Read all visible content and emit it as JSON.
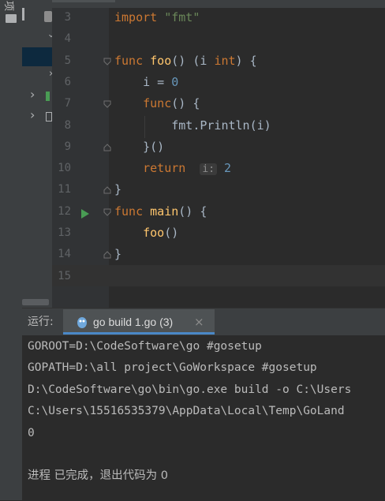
{
  "sidebar": {
    "vertical_label": "项",
    "chevrons": [
      "›",
      "›",
      "›",
      "›"
    ]
  },
  "editor": {
    "lines": [
      {
        "num": "3",
        "tokens": [
          [
            "kw",
            "import "
          ],
          [
            "str",
            "\"fmt\""
          ]
        ]
      },
      {
        "num": "4",
        "tokens": []
      },
      {
        "num": "5",
        "tokens": [
          [
            "kw",
            "func "
          ],
          [
            "fn",
            "foo"
          ],
          [
            "plain",
            "() (i "
          ],
          [
            "kw",
            "int"
          ],
          [
            "plain",
            ") {"
          ]
        ]
      },
      {
        "num": "6",
        "tokens": [
          [
            "plain",
            "    i = "
          ],
          [
            "num",
            "0"
          ]
        ]
      },
      {
        "num": "7",
        "tokens": [
          [
            "plain",
            "    "
          ],
          [
            "kw",
            "func"
          ],
          [
            "plain",
            "() {"
          ]
        ]
      },
      {
        "num": "8",
        "tokens": [
          [
            "plain",
            "        "
          ],
          [
            "pkgfn",
            "fmt.Println"
          ],
          [
            "plain",
            "(i)"
          ]
        ]
      },
      {
        "num": "9",
        "tokens": [
          [
            "plain",
            "    }()"
          ]
        ]
      },
      {
        "num": "10",
        "tokens": [
          [
            "plain",
            "    "
          ],
          [
            "kw",
            "return"
          ],
          [
            "plain",
            "  "
          ]
        ]
      },
      {
        "num": "11",
        "tokens": [
          [
            "plain",
            "}"
          ]
        ]
      },
      {
        "num": "12",
        "tokens": [
          [
            "kw",
            "func "
          ],
          [
            "fn",
            "main"
          ],
          [
            "plain",
            "() {"
          ]
        ]
      },
      {
        "num": "13",
        "tokens": [
          [
            "plain",
            "    "
          ],
          [
            "fn",
            "foo"
          ],
          [
            "plain",
            "()"
          ]
        ]
      },
      {
        "num": "14",
        "tokens": [
          [
            "plain",
            "}"
          ]
        ]
      },
      {
        "num": "15",
        "tokens": []
      }
    ],
    "inlay_hint": {
      "name": "i:",
      "value": "2"
    }
  },
  "run": {
    "label": "运行:",
    "tab_title": "go build 1.go (3)",
    "close": "×",
    "output": [
      "GOROOT=D:\\CodeSoftware\\go #gosetup",
      "GOPATH=D:\\all project\\GoWorkspace #gosetup",
      "D:\\CodeSoftware\\go\\bin\\go.exe build -o C:\\Users",
      "C:\\Users\\15516535379\\AppData\\Local\\Temp\\GoLand",
      "0",
      "",
      "进程 已完成，退出代码为 0"
    ]
  },
  "colors": {
    "keyword": "#cc7832",
    "string": "#6a8759",
    "number": "#6897bb",
    "function": "#ffc66d",
    "run_arrow": "#499c54"
  }
}
